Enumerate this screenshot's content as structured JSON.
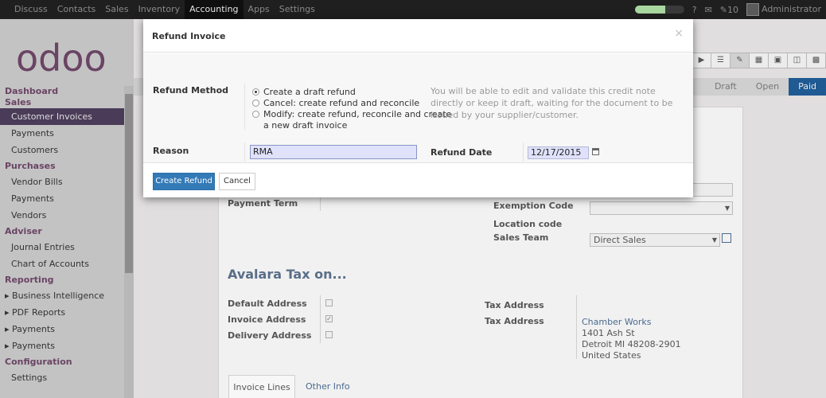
{
  "topbar": {
    "menu": [
      {
        "label": "Discuss"
      },
      {
        "label": "Contacts"
      },
      {
        "label": "Sales"
      },
      {
        "label": "Inventory"
      },
      {
        "label": "Accounting",
        "active": true
      },
      {
        "label": "Apps"
      },
      {
        "label": "Settings"
      }
    ],
    "progress_fraction": 0.62,
    "help_glyph": "?",
    "mail_glyph": "✉",
    "chat_count": "10",
    "user": "Administrator"
  },
  "sidebar": {
    "logo": "odoo",
    "sections": [
      {
        "title": "Dashboard",
        "items": []
      },
      {
        "title": "Sales",
        "items": [
          {
            "label": "Customer Invoices",
            "selected": true
          },
          {
            "label": "Payments"
          },
          {
            "label": "Customers"
          }
        ]
      },
      {
        "title": "Purchases",
        "items": [
          {
            "label": "Vendor Bills"
          },
          {
            "label": "Payments"
          },
          {
            "label": "Vendors"
          }
        ]
      },
      {
        "title": "Adviser",
        "items": [
          {
            "label": "Journal Entries"
          },
          {
            "label": "Chart of Accounts"
          }
        ]
      },
      {
        "title": "Reporting",
        "items": [
          {
            "label": "Business Intelligence",
            "caret": true
          },
          {
            "label": "PDF Reports",
            "caret": true
          },
          {
            "label": "Payments",
            "caret": true
          },
          {
            "label": "Payments",
            "caret": true
          }
        ]
      },
      {
        "title": "Configuration",
        "items": [
          {
            "label": "Settings"
          }
        ]
      }
    ]
  },
  "main": {
    "stages": [
      "Draft",
      "Open",
      "Paid"
    ],
    "current_stage": "Paid",
    "form": {
      "payment_term_label": "Payment Term",
      "exemption_code_label": "Exemption Code",
      "location_code_label": "Location code",
      "sales_team_label": "Sales Team",
      "sales_team_value": "Direct Sales",
      "avalara_title": "Avalara Tax on...",
      "default_address_label": "Default Address",
      "invoice_address_label": "Invoice Address",
      "delivery_address_label": "Delivery Address",
      "tax_address_label_1": "Tax Address",
      "tax_address_label_2": "Tax Address",
      "address_link": "Chamber Works",
      "address_line1": "1401 Ash St",
      "address_line2": "Detroit MI 48208-2901",
      "address_line3": "United States",
      "tabs": [
        "Invoice Lines",
        "Other Info"
      ]
    }
  },
  "modal": {
    "title": "Refund Invoice",
    "close": "×",
    "refund_method_label": "Refund Method",
    "options": [
      {
        "label": "Create a draft refund",
        "selected": true
      },
      {
        "label": "Cancel: create refund and reconcile"
      },
      {
        "label": "Modify: create refund, reconcile and create",
        "label2": "a new draft invoice"
      }
    ],
    "hint": "You will be able to edit and validate this credit note directly or keep it draft, waiting for the document to be issued by your supplier/customer.",
    "reason_label": "Reason",
    "reason_value": "RMA",
    "refund_date_label": "Refund Date",
    "refund_date_value": "12/17/2015",
    "create_button": "Create Refund",
    "cancel_button": "Cancel"
  }
}
